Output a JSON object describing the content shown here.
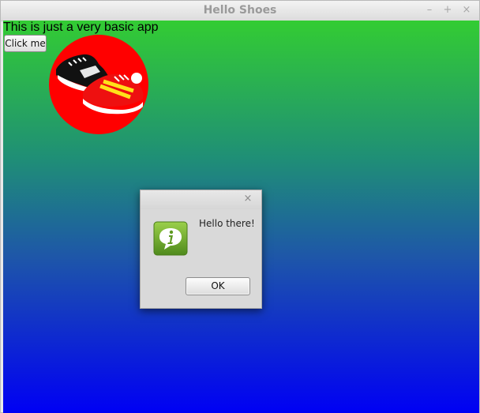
{
  "window": {
    "title": "Hello Shoes",
    "controls": {
      "minimize": "–",
      "maximize": "+",
      "close": "×"
    }
  },
  "content": {
    "paragraph": "This is just a very basic app",
    "button_label": "Click me",
    "image": {
      "icon": "shoes-logo-icon"
    }
  },
  "dialog": {
    "close": "×",
    "icon": "info-icon",
    "message": "Hello there!",
    "ok_label": "OK"
  },
  "colors": {
    "gradient_top": "#33cc33",
    "gradient_bottom": "#0000f4",
    "logo_circle": "#ff0000",
    "info_green": "#6fae2a"
  }
}
